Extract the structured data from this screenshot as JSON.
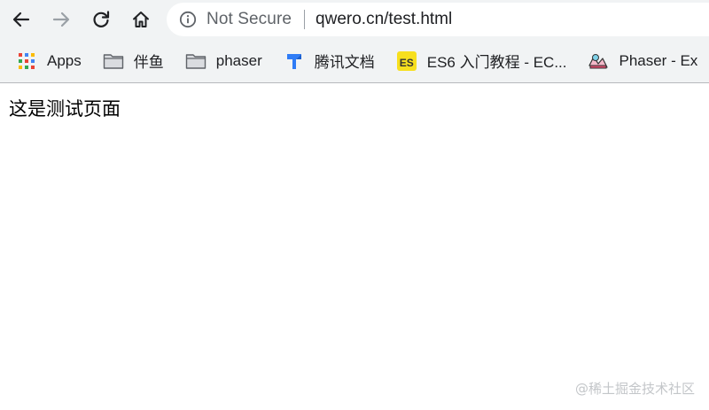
{
  "toolbar": {
    "back_icon": "arrow-left-icon",
    "forward_icon": "arrow-right-icon",
    "reload_icon": "reload-icon",
    "home_icon": "home-icon"
  },
  "omnibox": {
    "security_icon": "info-circle-icon",
    "security_text": "Not Secure",
    "url": "qwero.cn/test.html"
  },
  "bookmarks": [
    {
      "label": "Apps",
      "icon": "apps-grid-icon"
    },
    {
      "label": "伴鱼",
      "icon": "folder-icon"
    },
    {
      "label": "phaser",
      "icon": "folder-icon"
    },
    {
      "label": "腾讯文档",
      "icon": "tencent-docs-icon"
    },
    {
      "label": "ES6 入门教程 - EC...",
      "icon": "es-icon",
      "badge": "ES"
    },
    {
      "label": "Phaser - Ex",
      "icon": "phaser-icon"
    }
  ],
  "page": {
    "text": "这是测试页面"
  },
  "watermark": {
    "text": "@稀土掘金技术社区"
  },
  "colors": {
    "toolbar_bg": "#f1f3f4",
    "omnibox_bg": "#ffffff",
    "es_badge": "#f7df1e",
    "tencent_blue": "#2f7cf6"
  }
}
